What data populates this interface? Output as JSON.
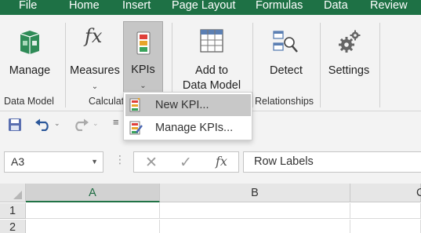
{
  "menu": {
    "tabs": [
      "File",
      "Home",
      "Insert",
      "Page Layout",
      "Formulas",
      "Data",
      "Review"
    ]
  },
  "ribbon": {
    "manage": "Manage",
    "measures": "Measures",
    "kpis": "KPIs",
    "add_to_data_model_1": "Add to",
    "add_to_data_model_2": "Data Model",
    "detect": "Detect",
    "settings": "Settings",
    "groups": {
      "data_model": "Data Model",
      "calculations": "Calculat",
      "relationships": "Relationships"
    }
  },
  "kpi_menu": {
    "new_kpi": "New KPI...",
    "manage_kpis": "Manage KPIs..."
  },
  "formula_bar": {
    "name_box": "A3",
    "formula": "Row Labels"
  },
  "grid": {
    "columns": [
      "A",
      "B",
      "C"
    ],
    "rows": [
      "1",
      "2"
    ]
  },
  "colors": {
    "accent": "#1e7145",
    "ribbon_bg": "#f3f3f3"
  }
}
